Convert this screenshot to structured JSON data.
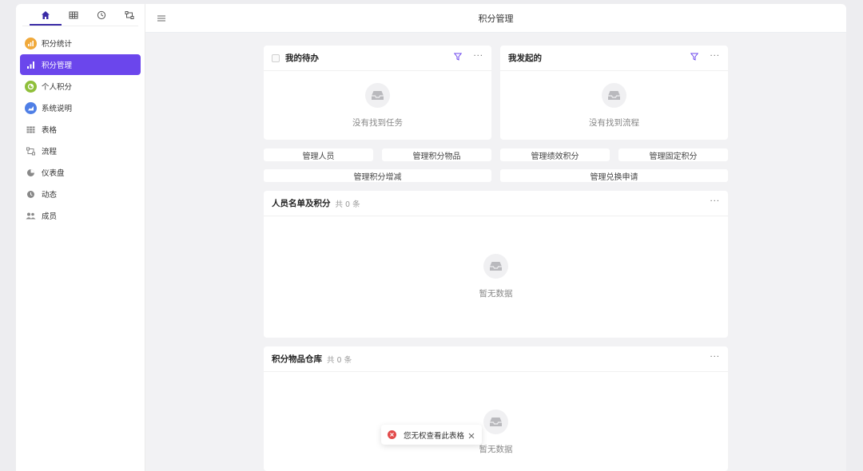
{
  "header": {
    "title": "积分管理"
  },
  "sidebar": {
    "tabs": [
      {
        "icon": "home-icon"
      },
      {
        "icon": "table-icon"
      },
      {
        "icon": "clock-icon"
      },
      {
        "icon": "flow-icon"
      }
    ],
    "items": [
      {
        "label": "积分统计",
        "icon": "chart-icon",
        "color": "#f0a93b"
      },
      {
        "label": "积分管理",
        "icon": "bar-chart-icon",
        "active": true
      },
      {
        "label": "个人积分",
        "icon": "pie-icon",
        "color": "#8fbf3a"
      },
      {
        "label": "系统说明",
        "icon": "area-chart-icon",
        "color": "#4f7fe6"
      },
      {
        "label": "表格",
        "icon": "grid-icon"
      },
      {
        "label": "流程",
        "icon": "flow-icon"
      },
      {
        "label": "仪表盘",
        "icon": "dashboard-icon"
      },
      {
        "label": "动态",
        "icon": "clock-icon"
      },
      {
        "label": "成员",
        "icon": "members-icon"
      }
    ]
  },
  "todo_card": {
    "title": "我的待办",
    "empty_text": "没有找到任务"
  },
  "started_card": {
    "title": "我发起的",
    "empty_text": "没有找到流程"
  },
  "actions": {
    "manage_staff": "管理人员",
    "manage_items": "管理积分物品",
    "manage_performance": "管理绩效积分",
    "manage_fixed": "管理固定积分",
    "manage_adjust": "管理积分增减",
    "manage_exchange": "管理兑换申请"
  },
  "staff_table": {
    "title": "人员名单及积分",
    "count": "共 0 条",
    "empty_text": "暂无数据"
  },
  "warehouse_table": {
    "title": "积分物品仓库",
    "count": "共 0 条",
    "empty_text": "暂无数据"
  },
  "toast": {
    "message": "您无权查看此表格"
  },
  "colors": {
    "accent": "#6b46ec",
    "brand_dark": "#3a2aa6",
    "error": "#e24a4a"
  }
}
